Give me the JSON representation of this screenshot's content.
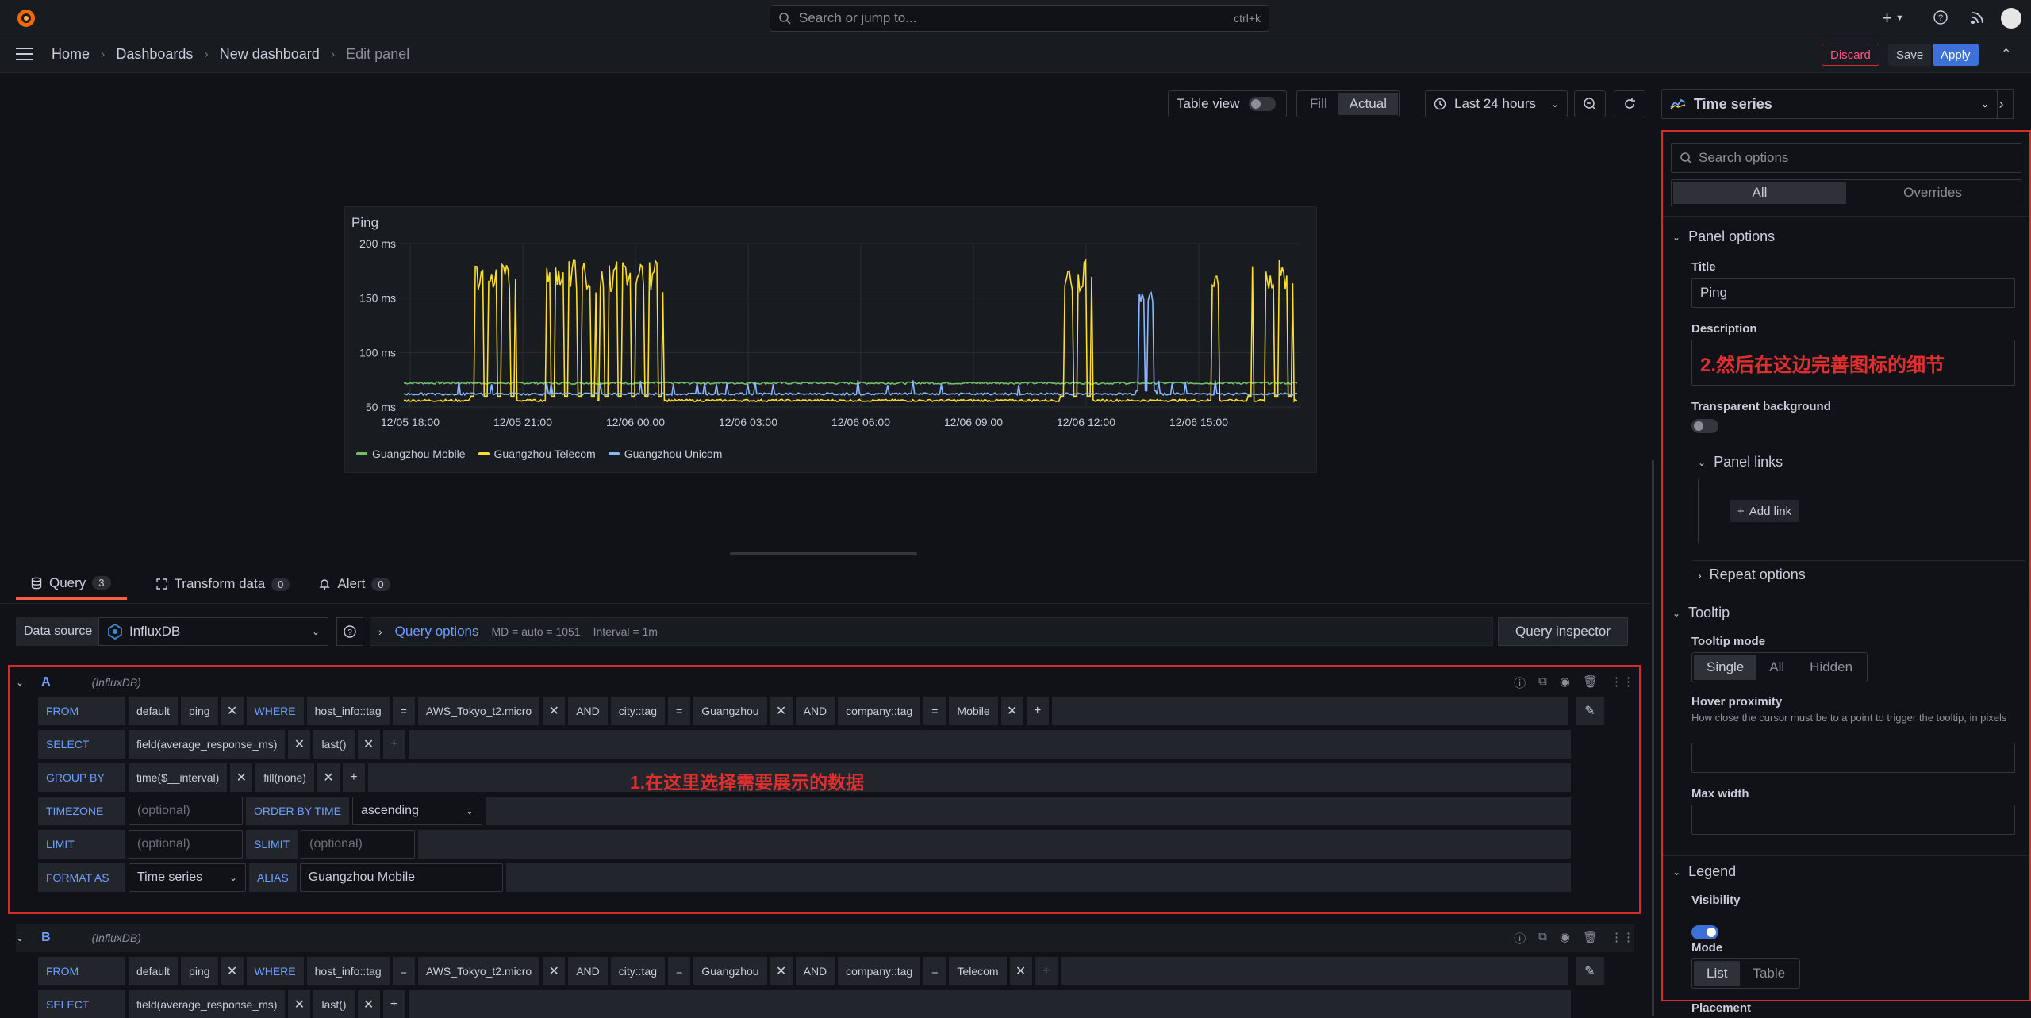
{
  "topbar": {
    "search_placeholder": "Search or jump to...",
    "search_shortcut": "ctrl+k"
  },
  "breadcrumb": [
    "Home",
    "Dashboards",
    "New dashboard",
    "Edit panel"
  ],
  "actions": {
    "discard": "Discard",
    "save": "Save",
    "apply": "Apply"
  },
  "toolbar": {
    "table_view": "Table view",
    "fill": "Fill",
    "actual": "Actual",
    "time_range": "Last 24 hours"
  },
  "panel": {
    "title": "Ping"
  },
  "chart_data": {
    "type": "line",
    "title": "Ping",
    "y_ticks": [
      "200 ms",
      "150 ms",
      "100 ms",
      "50 ms"
    ],
    "x_ticks": [
      "12/05 18:00",
      "12/05 21:00",
      "12/06 00:00",
      "12/06 03:00",
      "12/06 06:00",
      "12/06 09:00",
      "12/06 12:00",
      "12/06 15:00"
    ],
    "ylim": [
      50,
      200
    ],
    "series": [
      {
        "name": "Guangzhou Mobile",
        "color": "#73bf69",
        "baseline": 72
      },
      {
        "name": "Guangzhou Telecom",
        "color": "#fade2a",
        "baseline": 56
      },
      {
        "name": "Guangzhou Unicom",
        "color": "#8ab8ff",
        "baseline": 62
      }
    ]
  },
  "tabs": [
    {
      "label": "Query",
      "count": "3"
    },
    {
      "label": "Transform data",
      "count": "0"
    },
    {
      "label": "Alert",
      "count": "0"
    }
  ],
  "datasource": {
    "label": "Data source",
    "value": "InfluxDB",
    "query_options": "Query options",
    "md": "MD = auto = 1051",
    "interval": "Interval = 1m",
    "inspector": "Query inspector"
  },
  "queryA": {
    "ref": "A",
    "ds": "(InfluxDB)",
    "from": [
      "default",
      "ping"
    ],
    "where": [
      "host_info::tag",
      "=",
      "AWS_Tokyo_t2.micro",
      "AND",
      "city::tag",
      "=",
      "Guangzhou",
      "AND",
      "company::tag",
      "=",
      "Mobile"
    ],
    "select": [
      "field(average_response_ms)",
      "last()"
    ],
    "group_by": [
      "time($__interval)",
      "fill(none)"
    ],
    "timezone_ph": "(optional)",
    "order_by": "ascending",
    "limit_ph": "(optional)",
    "slimit_ph": "(optional)",
    "format_as": "Time series",
    "alias": "Guangzhou Mobile",
    "annotation": "1.在这里选择需要展示的数据"
  },
  "queryB": {
    "ref": "B",
    "ds": "(InfluxDB)",
    "from": [
      "default",
      "ping"
    ],
    "where": [
      "host_info::tag",
      "=",
      "AWS_Tokyo_t2.micro",
      "AND",
      "city::tag",
      "=",
      "Guangzhou",
      "AND",
      "company::tag",
      "=",
      "Telecom"
    ],
    "select": [
      "field(average_response_ms)",
      "last()"
    ]
  },
  "keywords": {
    "from": "FROM",
    "where": "WHERE",
    "select": "SELECT",
    "group_by": "GROUP BY",
    "timezone": "TIMEZONE",
    "order_by": "ORDER BY TIME",
    "limit": "LIMIT",
    "slimit": "SLIMIT",
    "format_as": "FORMAT AS",
    "alias": "ALIAS"
  },
  "options": {
    "viz": "Time series",
    "search_placeholder": "Search options",
    "tab_all": "All",
    "tab_overrides": "Overrides",
    "panel_options": "Panel options",
    "title_label": "Title",
    "title_value": "Ping",
    "description_label": "Description",
    "description_value": "2.然后在这边完善图标的细节",
    "transparent_label": "Transparent background",
    "panel_links": "Panel links",
    "add_link": "Add link",
    "repeat_options": "Repeat options",
    "tooltip": "Tooltip",
    "tooltip_mode": "Tooltip mode",
    "tooltip_modes": [
      "Single",
      "All",
      "Hidden"
    ],
    "hover_proximity": "Hover proximity",
    "hover_desc": "How close the cursor must be to a point to trigger the tooltip, in pixels",
    "max_width": "Max width",
    "legend": "Legend",
    "visibility": "Visibility",
    "mode": "Mode",
    "modes": [
      "List",
      "Table"
    ],
    "placement": "Placement"
  }
}
